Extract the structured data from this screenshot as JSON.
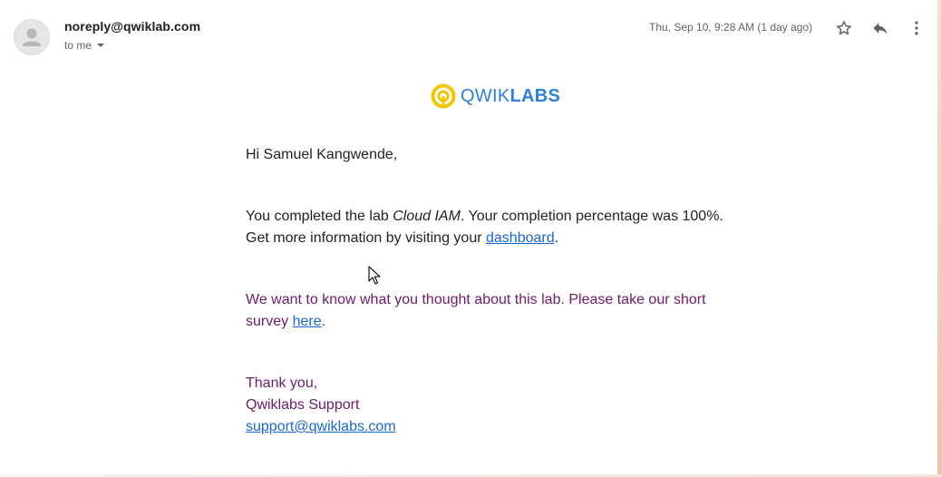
{
  "header": {
    "sender": "noreply@qwiklab.com",
    "recipient": "to me",
    "date": "Thu, Sep 10, 9:28 AM (1 day ago)"
  },
  "icons": {
    "avatar": "person-icon",
    "star": "star-icon",
    "reply": "reply-icon",
    "more": "more-vert-icon"
  },
  "logo": {
    "text_light": "QWIK",
    "text_bold": "LABS",
    "color": "#2f7fd9",
    "icon_color": "#f5c400"
  },
  "body": {
    "greeting": "Hi Samuel Kangwende,",
    "completion_prefix": "You completed the lab ",
    "lab_name": "Cloud IAM",
    "completion_suffix": ". Your completion percentage was 100%.",
    "info_prefix": "Get more information by visiting your ",
    "dashboard_link": "dashboard",
    "info_suffix": ".",
    "survey_text": "We want to know what you thought about this lab. Please take our short survey ",
    "survey_link": "here",
    "survey_suffix": ".",
    "thanks": "Thank you,",
    "signature": "Qwiklabs Support",
    "support_email": "support@qwiklabs.com"
  },
  "colors": {
    "link": "#1a66d2",
    "purple_text": "#6d1b6e"
  }
}
